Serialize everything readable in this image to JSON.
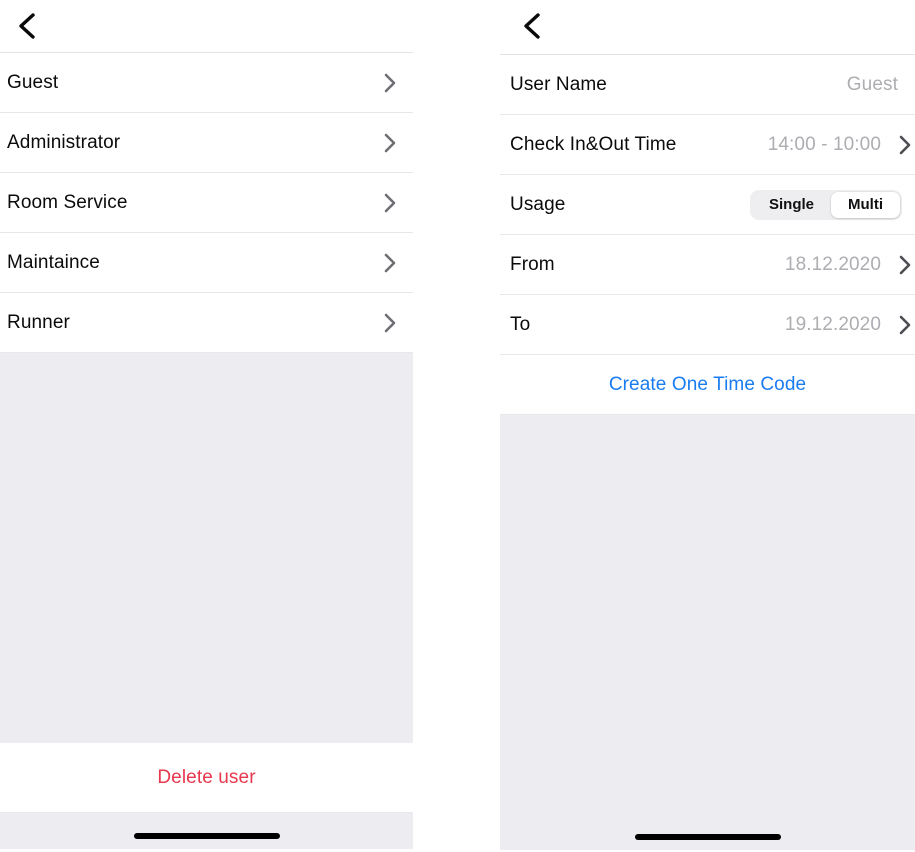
{
  "left_screen": {
    "back_label": "Back",
    "users": [
      {
        "label": "Guest"
      },
      {
        "label": "Administrator"
      },
      {
        "label": "Room Service"
      },
      {
        "label": "Maintaince"
      },
      {
        "label": "Runner"
      }
    ],
    "delete_label": "Delete user"
  },
  "right_screen": {
    "back_label": "Back",
    "rows": {
      "user_name_label": "User Name",
      "user_name_value": "Guest",
      "check_time_label": "Check In&Out Time",
      "check_time_value": "14:00 - 10:00",
      "usage_label": "Usage",
      "usage_option_single": "Single",
      "usage_option_multi": "Multi",
      "usage_selected": "Multi",
      "from_label": "From",
      "from_value": "18.12.2020",
      "to_label": "To",
      "to_value": "19.12.2020"
    },
    "create_code_label": "Create One Time Code"
  },
  "colors": {
    "link_blue": "#1a7cf0",
    "danger_red": "#e8374e",
    "value_gray": "#adadb2",
    "panel_gray": "#ececf1",
    "separator": "#e8e8ea"
  }
}
